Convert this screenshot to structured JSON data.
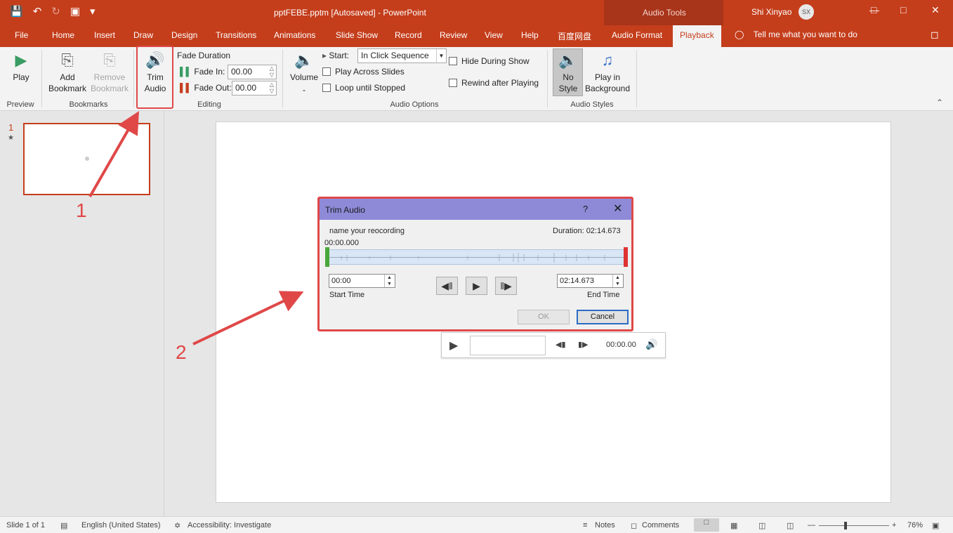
{
  "titlebar": {
    "doc_title": "pptFEBE.pptm [Autosaved]  -  PowerPoint",
    "context_title": "Audio Tools",
    "user_name": "Shi Xinyao",
    "user_initials": "SX",
    "accent": "#c43e1c"
  },
  "tabs": [
    "File",
    "Home",
    "Insert",
    "Draw",
    "Design",
    "Transitions",
    "Animations",
    "Slide Show",
    "Record",
    "Review",
    "View",
    "Help",
    "百度网盘",
    "Audio Format",
    "Playback"
  ],
  "active_tab": "Playback",
  "tell_me": "Tell me what you want to do",
  "ribbon": {
    "play": "Play",
    "add_bookmark": [
      "Add",
      "Bookmark"
    ],
    "remove_bookmark": [
      "Remove",
      "Bookmark"
    ],
    "trim_audio": [
      "Trim",
      "Audio"
    ],
    "fade_duration": "Fade Duration",
    "fade_in_label": "Fade In:",
    "fade_in_value": "00.00",
    "fade_out_label": "Fade Out:",
    "fade_out_value": "00.00",
    "volume": "Volume",
    "start_label": "Start:",
    "start_value": "In Click Sequence",
    "play_across": "Play Across Slides",
    "loop": "Loop until Stopped",
    "hide_during": "Hide During Show",
    "rewind_after": "Rewind after Playing",
    "no_style": [
      "No",
      "Style"
    ],
    "play_bg": [
      "Play in",
      "Background"
    ],
    "groups": {
      "preview": "Preview",
      "bookmarks": "Bookmarks",
      "editing": "Editing",
      "audio_options": "Audio Options",
      "audio_styles": "Audio Styles"
    }
  },
  "slides_pane": {
    "number": "1",
    "star": "★"
  },
  "audio_bar": {
    "time": "00:00.00"
  },
  "dialog": {
    "title": "Trim Audio",
    "help": "?",
    "name": "name your reocording",
    "duration": "Duration: 02:14.673",
    "position": "00:00.000",
    "start_value": "00:00",
    "start_label": "Start Time",
    "end_value": "02:14.673",
    "end_label": "End Time",
    "ok": "OK",
    "cancel": "Cancel"
  },
  "annotations": {
    "one": "1",
    "two": "2",
    "color": "#e04848"
  },
  "status": {
    "slide": "Slide 1 of 1",
    "language": "English (United States)",
    "accessibility": "Accessibility: Investigate",
    "notes": "Notes",
    "comments": "Comments",
    "zoom": "76%"
  }
}
